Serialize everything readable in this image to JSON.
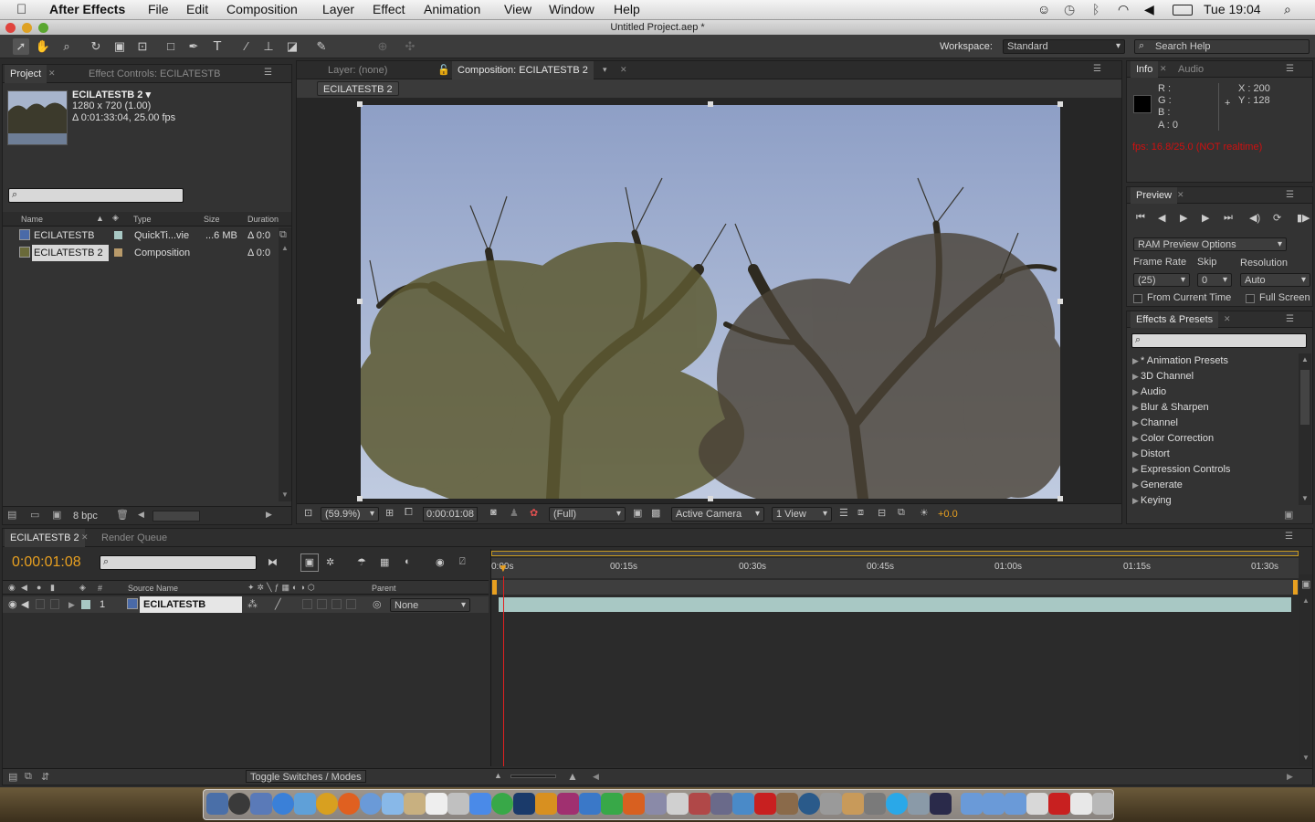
{
  "menubar": {
    "app": "After Effects",
    "items": [
      "File",
      "Edit",
      "Composition",
      "Layer",
      "Effect",
      "Animation",
      "View",
      "Window",
      "Help"
    ],
    "clock": "Tue 19:04"
  },
  "window": {
    "title": "Untitled Project.aep *"
  },
  "toolbar": {
    "workspace_label": "Workspace:",
    "workspace_value": "Standard",
    "search_help_placeholder": "Search Help"
  },
  "project_panel": {
    "tab_project": "Project",
    "tab_effect_controls": "Effect Controls: ECILATESTB",
    "item_name": "ECILATESTB 2 ▾",
    "item_dims": "1280 x 720 (1.00)",
    "item_duration": "Δ 0:01:33:04, 25.00 fps",
    "columns": {
      "name": "Name",
      "type": "Type",
      "size": "Size",
      "duration": "Duration"
    },
    "rows": [
      {
        "name": "ECILATESTB",
        "type": "QuickTi...vie",
        "size": "...6 MB",
        "duration": "Δ 0:0"
      },
      {
        "name": "ECILATESTB 2",
        "type": "Composition",
        "size": "",
        "duration": "Δ 0:0"
      }
    ],
    "bpc": "8 bpc"
  },
  "comp_panel": {
    "tab_layer": "Layer: (none)",
    "tab_comp": "Composition: ECILATESTB 2",
    "comp_chip": "ECILATESTB 2",
    "zoom": "(59.9%)",
    "timecode": "0:00:01:08",
    "resolution": "(Full)",
    "camera": "Active Camera",
    "views": "1 View",
    "exposure": "+0.0"
  },
  "info_panel": {
    "tab_info": "Info",
    "tab_audio": "Audio",
    "r": "R :",
    "g": "G :",
    "b": "B :",
    "a": "A :  0",
    "x": "X : 200",
    "y": "Y : 128",
    "fps_warning": "fps: 16.8/25.0 (NOT realtime)"
  },
  "preview_panel": {
    "tab": "Preview",
    "ram_options": "RAM Preview Options",
    "frame_rate_label": "Frame Rate",
    "skip_label": "Skip",
    "resolution_label": "Resolution",
    "frame_rate_value": "(25)",
    "skip_value": "0",
    "resolution_value": "Auto",
    "from_current": "From Current Time",
    "full_screen": "Full Screen"
  },
  "effects_panel": {
    "tab": "Effects & Presets",
    "items": [
      "* Animation Presets",
      "3D Channel",
      "Audio",
      "Blur & Sharpen",
      "Channel",
      "Color Correction",
      "Distort",
      "Expression Controls",
      "Generate",
      "Keying"
    ]
  },
  "timeline": {
    "tab_comp": "ECILATESTB 2",
    "tab_render": "Render Queue",
    "timecode": "0:00:01:08",
    "col_source": "Source Name",
    "col_parent": "Parent",
    "col_hash": "#",
    "layer_num": "1",
    "layer_name": "ECILATESTB",
    "parent_value": "None",
    "ruler": [
      "0:00s",
      "00:15s",
      "00:30s",
      "00:45s",
      "01:00s",
      "01:15s",
      "01:30s"
    ],
    "toggle_label": "Toggle Switches / Modes"
  },
  "colors": {
    "timecode": "#e8a020",
    "fps_warning": "#d01010",
    "playhead": "#e02020",
    "layer_bar": "#a8c8c4"
  }
}
